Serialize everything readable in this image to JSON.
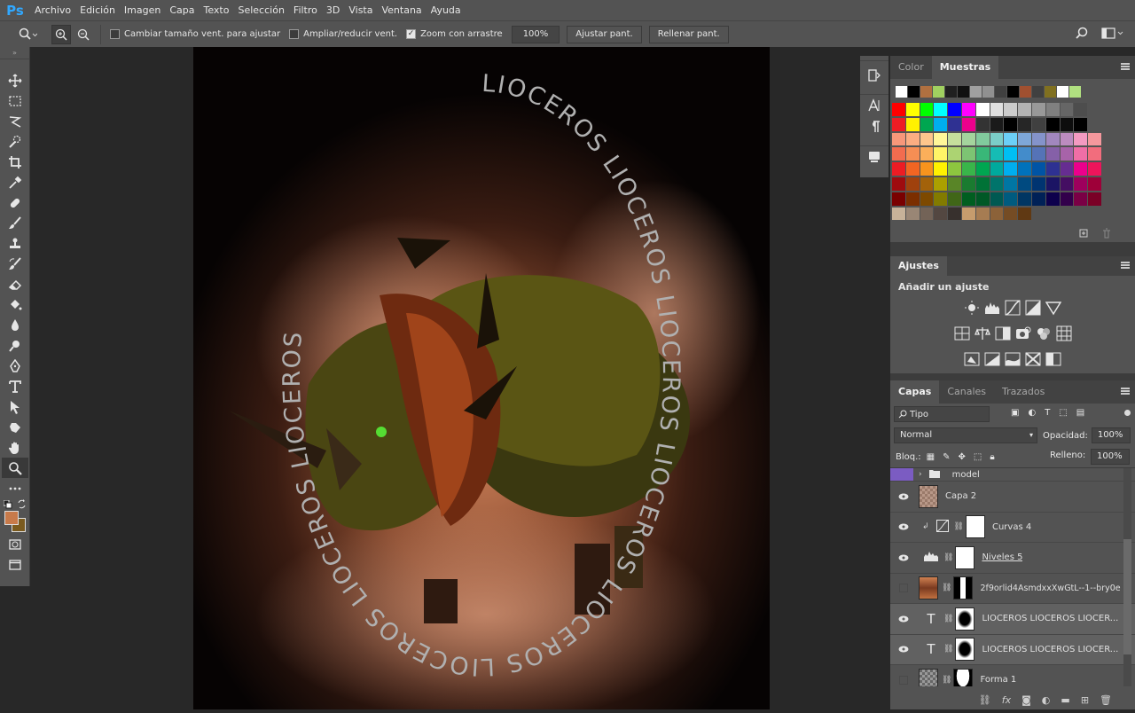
{
  "app": {
    "logo": "Ps"
  },
  "menu": [
    "Archivo",
    "Edición",
    "Imagen",
    "Capa",
    "Texto",
    "Selección",
    "Filtro",
    "3D",
    "Vista",
    "Ventana",
    "Ayuda"
  ],
  "options": {
    "resize_windows": "Cambiar tamaño vent. para ajustar",
    "resize_windows_checked": false,
    "zoom_all": "Ampliar/reducir vent.",
    "zoom_all_checked": false,
    "scrubby_zoom": "Zoom con arrastre",
    "scrubby_zoom_checked": true,
    "zoom_value": "100%",
    "fit_screen": "Ajustar pant.",
    "fill_screen": "Rellenar pant."
  },
  "tools": [
    "move-icon",
    "marquee-icon",
    "lasso-icon",
    "quick-select-icon",
    "crop-icon",
    "eyedropper-icon",
    "healing-icon",
    "brush-icon",
    "stamp-icon",
    "history-brush-icon",
    "eraser-icon",
    "paint-bucket-icon",
    "blur-icon",
    "dodge-icon",
    "pen-icon",
    "type-icon",
    "path-select-icon",
    "shape-icon",
    "hand-icon",
    "zoom-icon",
    "more-tools-icon"
  ],
  "colors": {
    "foreground": "#c87a4a",
    "background": "#7a5a1e",
    "accent": "#31a8ff",
    "layer_group_tag": "#7b5cc2"
  },
  "artwork": {
    "circular_text": "LIOCEROS LIOCEROS LIOCEROS LIOCEROS LIOCEROS LIOCEROS LIOCEROS LIOCEROS"
  },
  "swatches_panel": {
    "tabs": [
      "Color",
      "Muestras"
    ],
    "recent": [
      "#ffffff",
      "#000000",
      "#b07040",
      "#a0d060",
      "#202020",
      "#101010",
      "#a0a0a0",
      "#909090",
      "#404040",
      "#000000",
      "#a05030",
      "#404040",
      "#807020",
      "#ffffff",
      "#b0e080"
    ],
    "rows": [
      [
        "#ff0000",
        "#ffff00",
        "#00ff00",
        "#00ffff",
        "#0000ff",
        "#ff00ff",
        "#ffffff",
        "#e0e0e0",
        "#cccccc",
        "#b3b3b3",
        "#999999",
        "#808080",
        "#666666",
        "#4d4d4d"
      ],
      [
        "#ee1d24",
        "#fff100",
        "#00a650",
        "#00aeef",
        "#2f3192",
        "#ec008c",
        "#333333",
        "#1a1a1a",
        "#000000",
        "#262626",
        "#404040",
        "#000000",
        "#0d0d0d",
        "#000000"
      ],
      [
        "#f7977a",
        "#fbad82",
        "#fdc68c",
        "#fff799",
        "#c6df9c",
        "#a4d49d",
        "#81ca9d",
        "#7bcdc8",
        "#6ccff7",
        "#7ea7d8",
        "#8493ca",
        "#a187be",
        "#bc8cbf",
        "#f49ac1",
        "#f5989d"
      ],
      [
        "#f26c4f",
        "#f68e54",
        "#fbaf5a",
        "#fff467",
        "#acd372",
        "#7dc473",
        "#39b778",
        "#16bcb4",
        "#00bff3",
        "#438ccb",
        "#5573b7",
        "#8560a8",
        "#a763a9",
        "#f06ea6",
        "#f26d7d"
      ],
      [
        "#ed1c24",
        "#f26522",
        "#f7941d",
        "#fff200",
        "#8dc63f",
        "#39b54a",
        "#00a651",
        "#00a99d",
        "#00aeef",
        "#0072bc",
        "#0054a5",
        "#2e3192",
        "#662d91",
        "#ec008c",
        "#ed145b"
      ],
      [
        "#9e0b0f",
        "#a0410d",
        "#a3620a",
        "#aba000",
        "#598527",
        "#1a7b30",
        "#007236",
        "#00746b",
        "#0076a4",
        "#004a80",
        "#003471",
        "#1b1464",
        "#440e62",
        "#9e005d",
        "#9e0039"
      ],
      [
        "#790000",
        "#7b2e00",
        "#7d4900",
        "#827b00",
        "#406618",
        "#005e20",
        "#005826",
        "#005952",
        "#005b7f",
        "#003663",
        "#002157",
        "#0d004c",
        "#32004b",
        "#7a0045",
        "#7a0026"
      ],
      [
        "#c7b299",
        "#998675",
        "#736357",
        "#534741",
        "#37302d",
        "#c69c6d",
        "#a67c52",
        "#8c6239",
        "#754c24",
        "#603913"
      ]
    ]
  },
  "adjustments_panel": {
    "tab": "Ajustes",
    "title": "Añadir un ajuste"
  },
  "layers_panel": {
    "tabs": [
      "Capas",
      "Canales",
      "Trazados"
    ],
    "filter_kind": "Tipo",
    "blend_mode": "Normal",
    "opacity_label": "Opacidad:",
    "opacity_value": "100%",
    "lock_label": "Bloq.:",
    "fill_label": "Relleno:",
    "fill_value": "100%",
    "layers": [
      {
        "name": "model",
        "type": "group",
        "visible": false
      },
      {
        "name": "Capa 2",
        "type": "pixel",
        "visible": true
      },
      {
        "name": "Curvas 4",
        "type": "curves",
        "visible": true
      },
      {
        "name": "Niveles 5",
        "type": "levels",
        "visible": true
      },
      {
        "name": "2f9orlid4AsmdxxXwGtL--1--bry0e",
        "type": "image",
        "visible": false
      },
      {
        "name": "LIOCEROS LIOCEROS LIOCER...",
        "type": "text",
        "visible": true
      },
      {
        "name": "LIOCEROS LIOCEROS LIOCER...",
        "type": "text",
        "visible": true
      },
      {
        "name": "Forma 1",
        "type": "shape",
        "visible": false
      }
    ]
  }
}
